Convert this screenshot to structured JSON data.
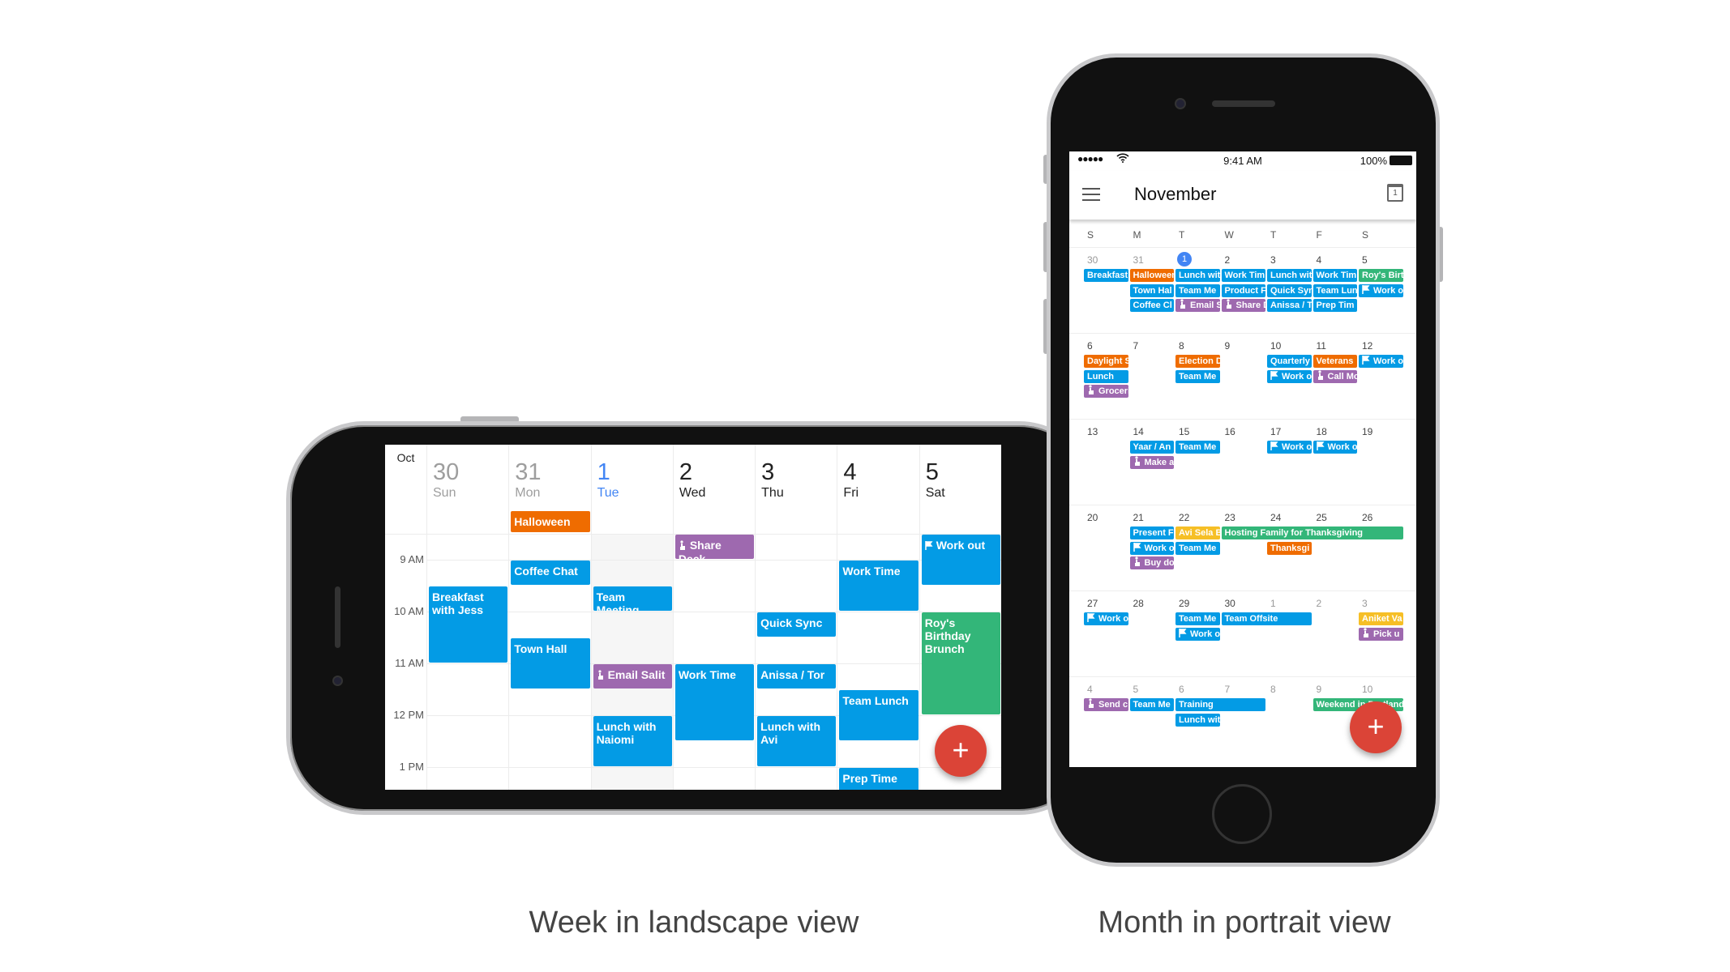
{
  "colors": {
    "blue": "#039be5",
    "orange": "#ef6c00",
    "purple": "#9e69af",
    "green": "#33b679",
    "yellow": "#f6bf26",
    "fab": "#db4437",
    "today": "#4285f4"
  },
  "captions": {
    "week": "Week in landscape view",
    "month": "Month in portrait view"
  },
  "week_view": {
    "month_label": "Oct",
    "days": [
      {
        "num": "30",
        "name": "Sun",
        "state": "past"
      },
      {
        "num": "31",
        "name": "Mon",
        "state": "past"
      },
      {
        "num": "1",
        "name": "Tue",
        "state": "today"
      },
      {
        "num": "2",
        "name": "Wed",
        "state": ""
      },
      {
        "num": "3",
        "name": "Thu",
        "state": ""
      },
      {
        "num": "4",
        "name": "Fri",
        "state": ""
      },
      {
        "num": "5",
        "name": "Sat",
        "state": ""
      }
    ],
    "hours": [
      {
        "label": "9 AM",
        "h": 9
      },
      {
        "label": "10 AM",
        "h": 10
      },
      {
        "label": "11 AM",
        "h": 11
      },
      {
        "label": "12 PM",
        "h": 12
      },
      {
        "label": "1 PM",
        "h": 13
      }
    ],
    "all_day": [
      {
        "label": "Halloween",
        "day": 1,
        "color": "orange"
      }
    ],
    "events": [
      {
        "label": "Share Deck",
        "day": 3,
        "start": 8.5,
        "end": 9,
        "color": "purple",
        "icon": "reminder-icon"
      },
      {
        "label": "Work out",
        "day": 6,
        "start": 8.5,
        "end": 9.5,
        "color": "blue",
        "icon": "flag-icon"
      },
      {
        "label": "Coffee Chat",
        "day": 1,
        "start": 9,
        "end": 9.5,
        "color": "blue"
      },
      {
        "label": "Work Time",
        "day": 5,
        "start": 9,
        "end": 10,
        "color": "blue"
      },
      {
        "label": "Breakfast with Jess",
        "day": 0,
        "start": 9.5,
        "end": 11,
        "color": "blue"
      },
      {
        "label": "Team Meeting",
        "day": 2,
        "start": 9.5,
        "end": 10,
        "color": "blue"
      },
      {
        "label": "Quick Sync",
        "day": 4,
        "start": 10,
        "end": 10.5,
        "color": "blue"
      },
      {
        "label": "Roy's Birthday Brunch",
        "day": 6,
        "start": 10,
        "end": 12,
        "color": "green"
      },
      {
        "label": "Town Hall",
        "day": 1,
        "start": 10.5,
        "end": 11.5,
        "color": "blue"
      },
      {
        "label": "Email Salit",
        "day": 2,
        "start": 11,
        "end": 11.5,
        "color": "purple",
        "icon": "reminder-icon"
      },
      {
        "label": "Work Time",
        "day": 3,
        "start": 11,
        "end": 12.5,
        "color": "blue"
      },
      {
        "label": "Anissa / Tor",
        "day": 4,
        "start": 11,
        "end": 11.5,
        "color": "blue"
      },
      {
        "label": "Team Lunch",
        "day": 5,
        "start": 11.5,
        "end": 12.5,
        "color": "blue"
      },
      {
        "label": "Lunch with Naiomi",
        "day": 2,
        "start": 12,
        "end": 13,
        "color": "blue"
      },
      {
        "label": "Lunch with Avi",
        "day": 4,
        "start": 12,
        "end": 13,
        "color": "blue"
      },
      {
        "label": "Prep Time",
        "day": 5,
        "start": 13,
        "end": 13.5,
        "color": "blue"
      }
    ],
    "fab_label": "+"
  },
  "month_view": {
    "status": {
      "time": "9:41 AM",
      "battery": "100%"
    },
    "title": "November",
    "calendar_icon_day": "1",
    "weekdays": [
      "S",
      "M",
      "T",
      "W",
      "T",
      "F",
      "S"
    ],
    "weeks": [
      {
        "days": [
          {
            "n": "30",
            "other": true
          },
          {
            "n": "31",
            "other": true
          },
          {
            "n": "1",
            "today": true
          },
          {
            "n": "2"
          },
          {
            "n": "3"
          },
          {
            "n": "4"
          },
          {
            "n": "5"
          }
        ],
        "events": [
          {
            "label": "Breakfast",
            "day": 0,
            "color": "blue"
          },
          {
            "label": "Halloween",
            "day": 1,
            "color": "orange"
          },
          {
            "label": "Lunch wit",
            "day": 2,
            "color": "blue"
          },
          {
            "label": "Work Tim",
            "day": 3,
            "color": "blue"
          },
          {
            "label": "Lunch wit",
            "day": 4,
            "color": "blue"
          },
          {
            "label": "Work Tim",
            "day": 5,
            "color": "blue"
          },
          {
            "label": "Roy's Birt",
            "day": 6,
            "color": "green"
          },
          {
            "label": "Town Hal",
            "day": 1,
            "color": "blue"
          },
          {
            "label": "Team Me",
            "day": 2,
            "color": "blue"
          },
          {
            "label": "Product F",
            "day": 3,
            "color": "blue"
          },
          {
            "label": "Quick Syn",
            "day": 4,
            "color": "blue"
          },
          {
            "label": "Team Lun",
            "day": 5,
            "color": "blue"
          },
          {
            "label": "Work o",
            "day": 6,
            "color": "blue",
            "icon": "flag-icon"
          },
          {
            "label": "Coffee Cl",
            "day": 1,
            "color": "blue"
          },
          {
            "label": "Email S",
            "day": 2,
            "color": "purple",
            "icon": "reminder-icon"
          },
          {
            "label": "Share D",
            "day": 3,
            "color": "purple",
            "icon": "reminder-icon"
          },
          {
            "label": "Anissa / T",
            "day": 4,
            "color": "blue"
          },
          {
            "label": "Prep Tim",
            "day": 5,
            "color": "blue"
          }
        ]
      },
      {
        "days": [
          {
            "n": "6"
          },
          {
            "n": "7"
          },
          {
            "n": "8"
          },
          {
            "n": "9"
          },
          {
            "n": "10"
          },
          {
            "n": "11"
          },
          {
            "n": "12"
          }
        ],
        "events": [
          {
            "label": "Daylight S",
            "day": 0,
            "color": "orange"
          },
          {
            "label": "Election D",
            "day": 2,
            "color": "orange"
          },
          {
            "label": "Quarterly",
            "day": 4,
            "color": "blue"
          },
          {
            "label": "Veterans",
            "day": 5,
            "color": "orange"
          },
          {
            "label": "Work o",
            "day": 6,
            "color": "blue",
            "icon": "flag-icon"
          },
          {
            "label": "Lunch",
            "day": 0,
            "color": "blue"
          },
          {
            "label": "Team Me",
            "day": 2,
            "color": "blue"
          },
          {
            "label": "Work o",
            "day": 4,
            "color": "blue",
            "icon": "flag-icon"
          },
          {
            "label": "Call Mo",
            "day": 5,
            "color": "purple",
            "icon": "reminder-icon"
          },
          {
            "label": "Groceri",
            "day": 0,
            "color": "purple",
            "icon": "reminder-icon"
          }
        ]
      },
      {
        "days": [
          {
            "n": "13"
          },
          {
            "n": "14"
          },
          {
            "n": "15"
          },
          {
            "n": "16"
          },
          {
            "n": "17"
          },
          {
            "n": "18"
          },
          {
            "n": "19"
          }
        ],
        "events": [
          {
            "label": "Yaar / An",
            "day": 1,
            "color": "blue"
          },
          {
            "label": "Team Me",
            "day": 2,
            "color": "blue"
          },
          {
            "label": "Work o",
            "day": 4,
            "color": "blue",
            "icon": "flag-icon"
          },
          {
            "label": "Work o",
            "day": 5,
            "color": "blue",
            "icon": "flag-icon"
          },
          {
            "label": "Make a",
            "day": 1,
            "color": "purple",
            "icon": "reminder-icon"
          }
        ]
      },
      {
        "days": [
          {
            "n": "20"
          },
          {
            "n": "21"
          },
          {
            "n": "22"
          },
          {
            "n": "23"
          },
          {
            "n": "24"
          },
          {
            "n": "25"
          },
          {
            "n": "26"
          }
        ],
        "events": [
          {
            "label": "Present F",
            "day": 1,
            "color": "blue"
          },
          {
            "label": "Avi Sela B",
            "day": 2,
            "color": "yellow"
          },
          {
            "label": "Hosting Family for Thanksgiving",
            "day": 3,
            "span": 4,
            "color": "green"
          },
          {
            "label": "Work o",
            "day": 1,
            "color": "blue",
            "icon": "flag-icon"
          },
          {
            "label": "Team Me",
            "day": 2,
            "color": "blue"
          },
          {
            "label": "Thanksgi",
            "day": 4,
            "color": "orange"
          },
          {
            "label": "Buy do",
            "day": 1,
            "color": "purple",
            "icon": "reminder-icon"
          }
        ]
      },
      {
        "days": [
          {
            "n": "27"
          },
          {
            "n": "28"
          },
          {
            "n": "29"
          },
          {
            "n": "30"
          },
          {
            "n": "1",
            "other": true
          },
          {
            "n": "2",
            "other": true
          },
          {
            "n": "3",
            "other": true
          }
        ],
        "events": [
          {
            "label": "Work o",
            "day": 0,
            "color": "blue",
            "icon": "flag-icon"
          },
          {
            "label": "Team Me",
            "day": 2,
            "color": "blue"
          },
          {
            "label": "Team Offsite",
            "day": 3,
            "span": 2,
            "color": "blue"
          },
          {
            "label": "Aniket Va",
            "day": 6,
            "color": "yellow"
          },
          {
            "label": "Work o",
            "day": 2,
            "color": "blue",
            "icon": "flag-icon"
          },
          {
            "label": "Pick u",
            "day": 6,
            "color": "purple",
            "icon": "reminder-icon"
          }
        ]
      },
      {
        "days": [
          {
            "n": "4",
            "other": true
          },
          {
            "n": "5",
            "other": true
          },
          {
            "n": "6",
            "other": true
          },
          {
            "n": "7",
            "other": true
          },
          {
            "n": "8",
            "other": true
          },
          {
            "n": "9",
            "other": true
          },
          {
            "n": "10",
            "other": true
          }
        ],
        "events": [
          {
            "label": "Send c",
            "day": 0,
            "color": "purple",
            "icon": "reminder-icon"
          },
          {
            "label": "Team Me",
            "day": 1,
            "color": "blue"
          },
          {
            "label": "Training",
            "day": 2,
            "span": 2,
            "color": "blue"
          },
          {
            "label": "Weekend in Portland",
            "day": 5,
            "span": 2,
            "color": "green"
          },
          {
            "label": "Lunch wit",
            "day": 2,
            "color": "blue"
          }
        ]
      }
    ],
    "fab_label": "+"
  }
}
